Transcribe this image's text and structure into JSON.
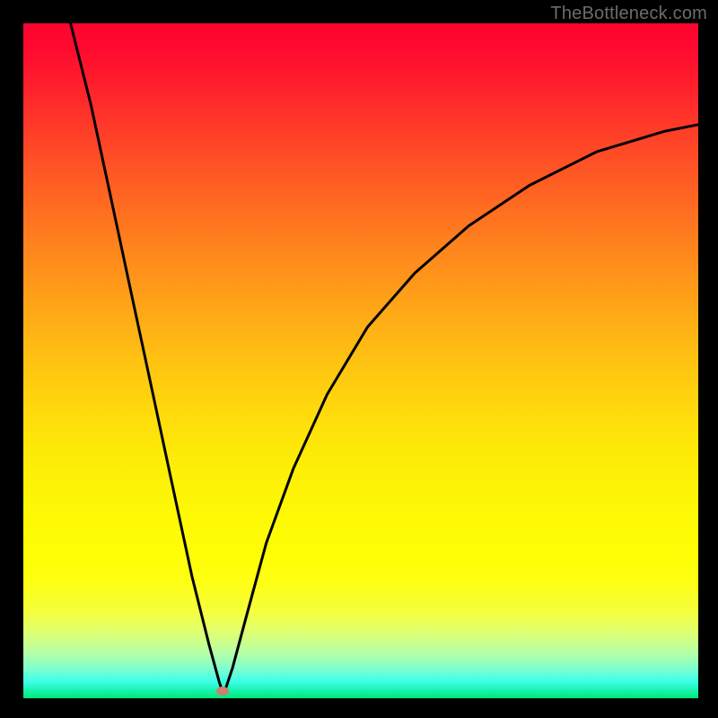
{
  "watermark": "TheBottleneck.com",
  "marker": {
    "x_pct": 29.5,
    "y_pct": 99.0,
    "color": "#cd7e71"
  },
  "chart_data": {
    "type": "line",
    "title": "",
    "xlabel": "",
    "ylabel": "",
    "xlim_pct": [
      0,
      100
    ],
    "ylim_pct": [
      0,
      100
    ],
    "min_x_pct": 29.5,
    "series": [
      {
        "name": "bottleneck-curve",
        "points_pct": [
          {
            "x": 7.0,
            "y": 0.0
          },
          {
            "x": 10.0,
            "y": 12.0
          },
          {
            "x": 13.0,
            "y": 26.0
          },
          {
            "x": 16.0,
            "y": 40.0
          },
          {
            "x": 19.0,
            "y": 54.0
          },
          {
            "x": 22.0,
            "y": 68.0
          },
          {
            "x": 25.0,
            "y": 82.0
          },
          {
            "x": 27.5,
            "y": 92.0
          },
          {
            "x": 29.0,
            "y": 97.5
          },
          {
            "x": 29.5,
            "y": 99.0
          },
          {
            "x": 30.0,
            "y": 98.5
          },
          {
            "x": 31.0,
            "y": 95.5
          },
          {
            "x": 33.0,
            "y": 88.0
          },
          {
            "x": 36.0,
            "y": 77.0
          },
          {
            "x": 40.0,
            "y": 66.0
          },
          {
            "x": 45.0,
            "y": 55.0
          },
          {
            "x": 51.0,
            "y": 45.0
          },
          {
            "x": 58.0,
            "y": 37.0
          },
          {
            "x": 66.0,
            "y": 30.0
          },
          {
            "x": 75.0,
            "y": 24.0
          },
          {
            "x": 85.0,
            "y": 19.0
          },
          {
            "x": 95.0,
            "y": 16.0
          },
          {
            "x": 100.0,
            "y": 15.0
          }
        ]
      }
    ],
    "gradient_stops": [
      {
        "pct": 0,
        "color": "#ff032f"
      },
      {
        "pct": 50,
        "color": "#ffc212"
      },
      {
        "pct": 80,
        "color": "#feff15"
      },
      {
        "pct": 100,
        "color": "#01e772"
      }
    ]
  }
}
